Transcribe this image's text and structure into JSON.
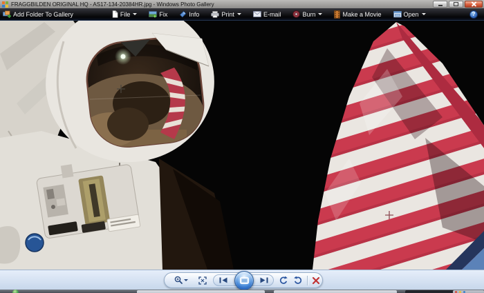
{
  "window": {
    "title": "FRAGGBILDEN ORIGINAL HQ - AS17-134-20384HR.jpg - Windows Photo Gallery",
    "help_glyph": "?"
  },
  "toolbar": {
    "add_folder_label": "Add Folder To Gallery",
    "items": [
      {
        "label": "File",
        "dropdown": true
      },
      {
        "label": "Fix",
        "dropdown": false
      },
      {
        "label": "Info",
        "dropdown": false
      },
      {
        "label": "Print",
        "dropdown": true
      },
      {
        "label": "E-mail",
        "dropdown": false
      },
      {
        "label": "Burn",
        "dropdown": true
      },
      {
        "label": "Make a Movie",
        "dropdown": false
      },
      {
        "label": "Open",
        "dropdown": true
      }
    ]
  },
  "photo": {
    "subject": "Apollo astronaut in white spacesuit beside the American flag against black lunar sky"
  },
  "colors": {
    "titlebar_gray": "#a3a2a0",
    "toolbar_black": "#0b0c10",
    "pane_blue": "#d3e0f1",
    "accent_blue": "#27487f",
    "flag_red": "#ca3a4e",
    "delete_red": "#c13232",
    "sky_black": "#050505"
  }
}
